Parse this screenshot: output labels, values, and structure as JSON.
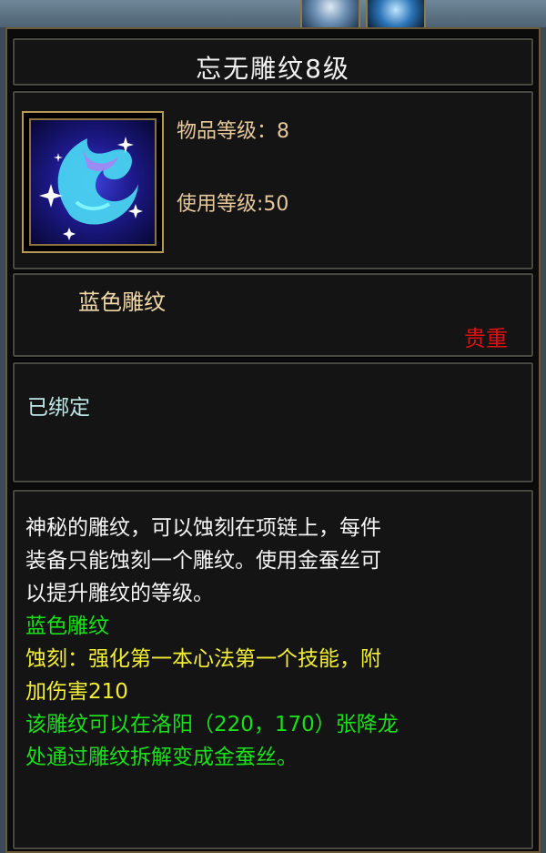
{
  "title": "忘无雕纹8级",
  "item_level": "物品等级：8",
  "use_level": "使用等级:50",
  "quality": "蓝色雕纹",
  "rarity": "贵重",
  "binding": "已绑定",
  "description": [
    "神秘的雕纹，可以蚀刻在项链上，每件",
    "装备只能蚀刻一个雕纹。使用金蚕丝可",
    "以提升雕纹的等级。"
  ],
  "effect_title": "蓝色雕纹",
  "effect": [
    "蚀刻：强化第一本心法第一个技能，附",
    "加伤害210"
  ],
  "disassemble": [
    "该雕纹可以在洛阳（220，170）张降龙",
    "处通过雕纹拆解变成金蚕丝。"
  ],
  "icons": {
    "top_left": "frost-skill-icon",
    "top_right": "water-skill-icon",
    "item": "blue-engraving-icon"
  }
}
